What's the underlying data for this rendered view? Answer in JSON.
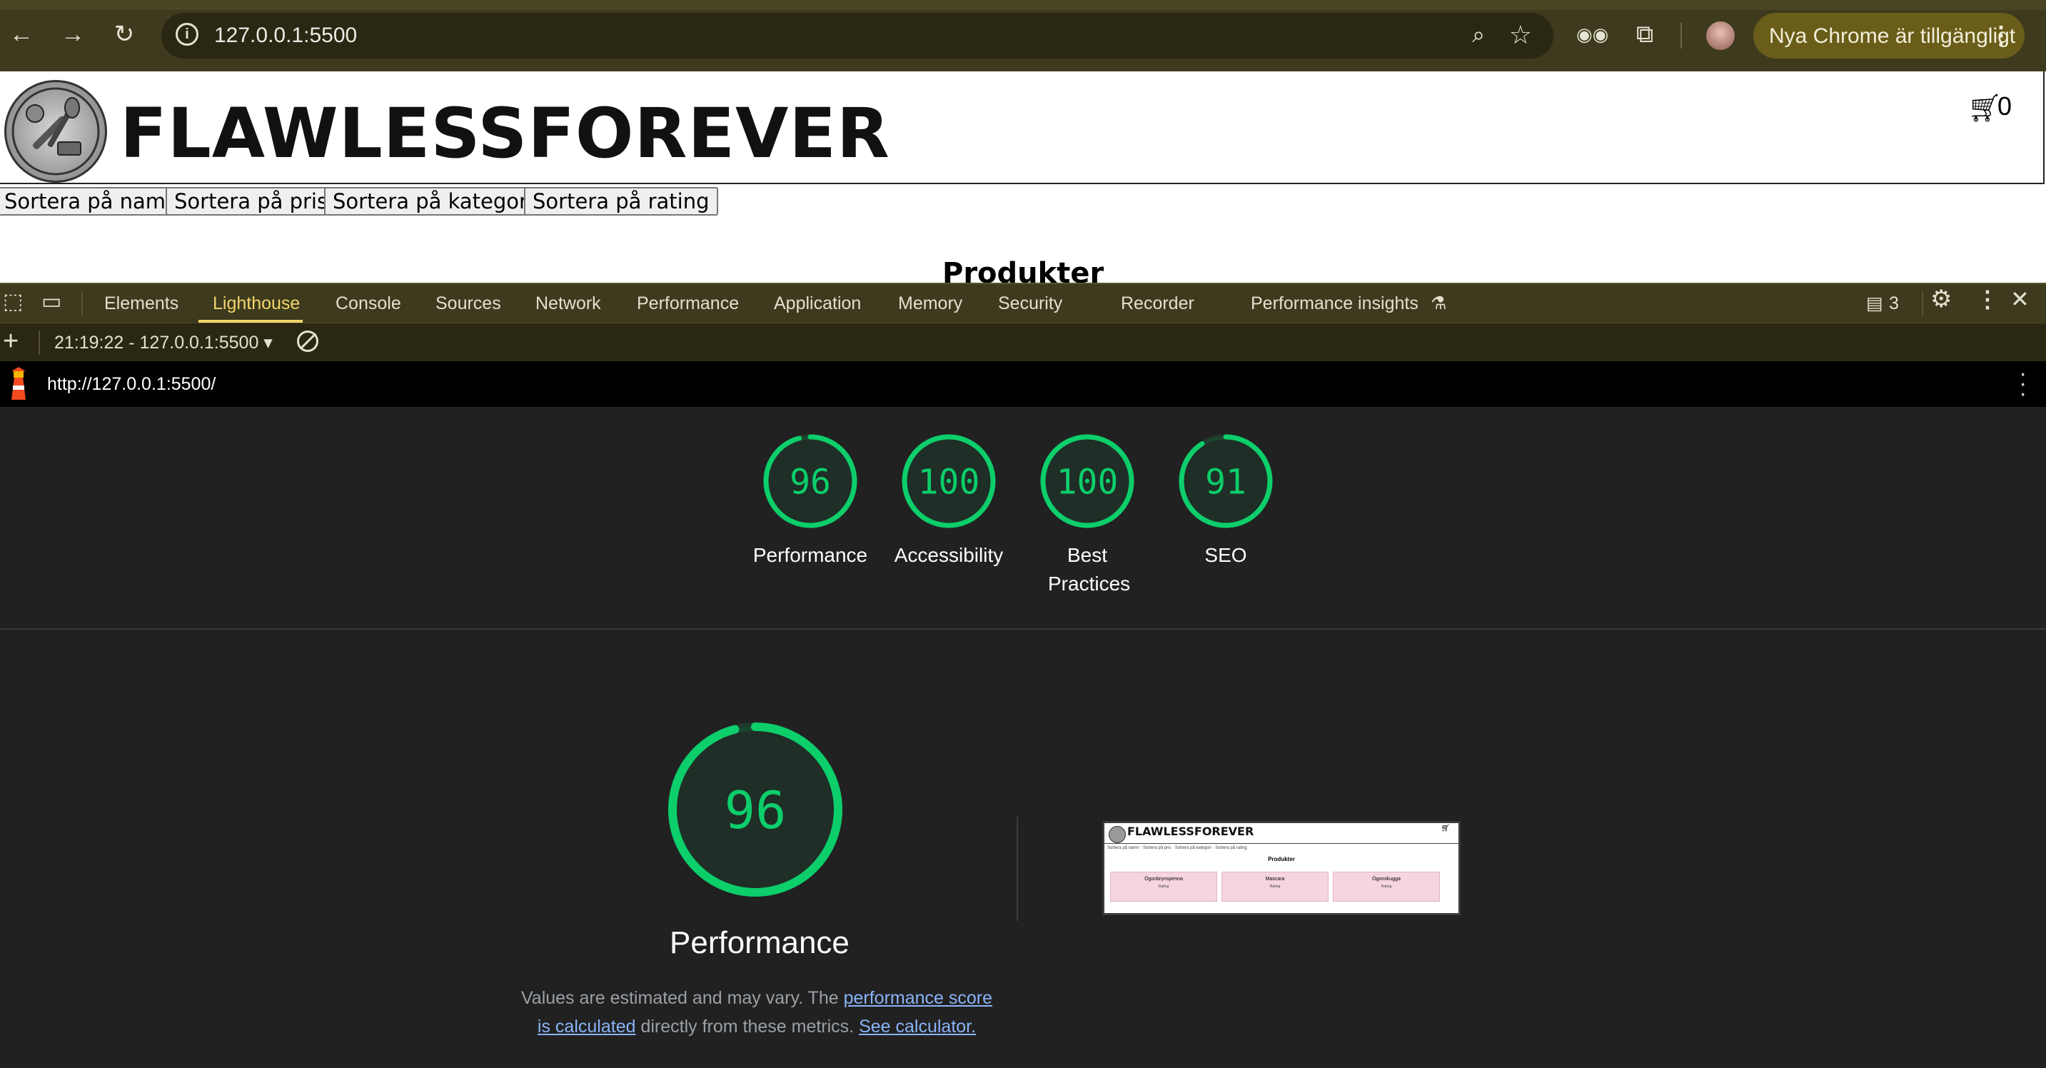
{
  "browser": {
    "url": "127.0.0.1:5500",
    "update_label": "Nya Chrome är tillgängligt"
  },
  "site": {
    "title": "FLAWLESSFOREVER",
    "cart_count": "0",
    "sort_buttons": [
      "Sortera på namn",
      "Sortera på pris",
      "Sortera på kategori",
      "Sortera på rating"
    ],
    "products_heading": "Produkter"
  },
  "devtools": {
    "tabs": [
      "Elements",
      "Lighthouse",
      "Console",
      "Sources",
      "Network",
      "Performance",
      "Application",
      "Memory",
      "Security",
      "Recorder",
      "Performance insights"
    ],
    "active_tab": "Lighthouse",
    "issues_count": "3",
    "report_selector": "21:19:22 - 127.0.0.1:5500",
    "report_url": "http://127.0.0.1:5500/"
  },
  "lighthouse": {
    "scores": [
      {
        "label": "Performance",
        "score": "96",
        "value": 96
      },
      {
        "label": "Accessibility",
        "score": "100",
        "value": 100
      },
      {
        "label": "Best Practices",
        "score": "100",
        "value": 100
      },
      {
        "label": "SEO",
        "score": "91",
        "value": 91
      }
    ],
    "main": {
      "score": "96",
      "value": 96,
      "title": "Performance",
      "desc_prefix": "Values are estimated and may vary. The ",
      "desc_link1": "performance score is calculated",
      "desc_middle": " directly from these metrics. ",
      "desc_link2": "See calculator."
    },
    "thumbnail": {
      "title": "FLAWLESSFOREVER",
      "sort_text": "Sortera på namn · Sortera på pris · Sortera på kategori · Sortera på rating",
      "heading": "Produkter",
      "cards": [
        "Ögonbrynspenna",
        "Mascara",
        "Ögonskugga"
      ],
      "card_rating": "Rating"
    },
    "score_color": "#0cce6b"
  }
}
